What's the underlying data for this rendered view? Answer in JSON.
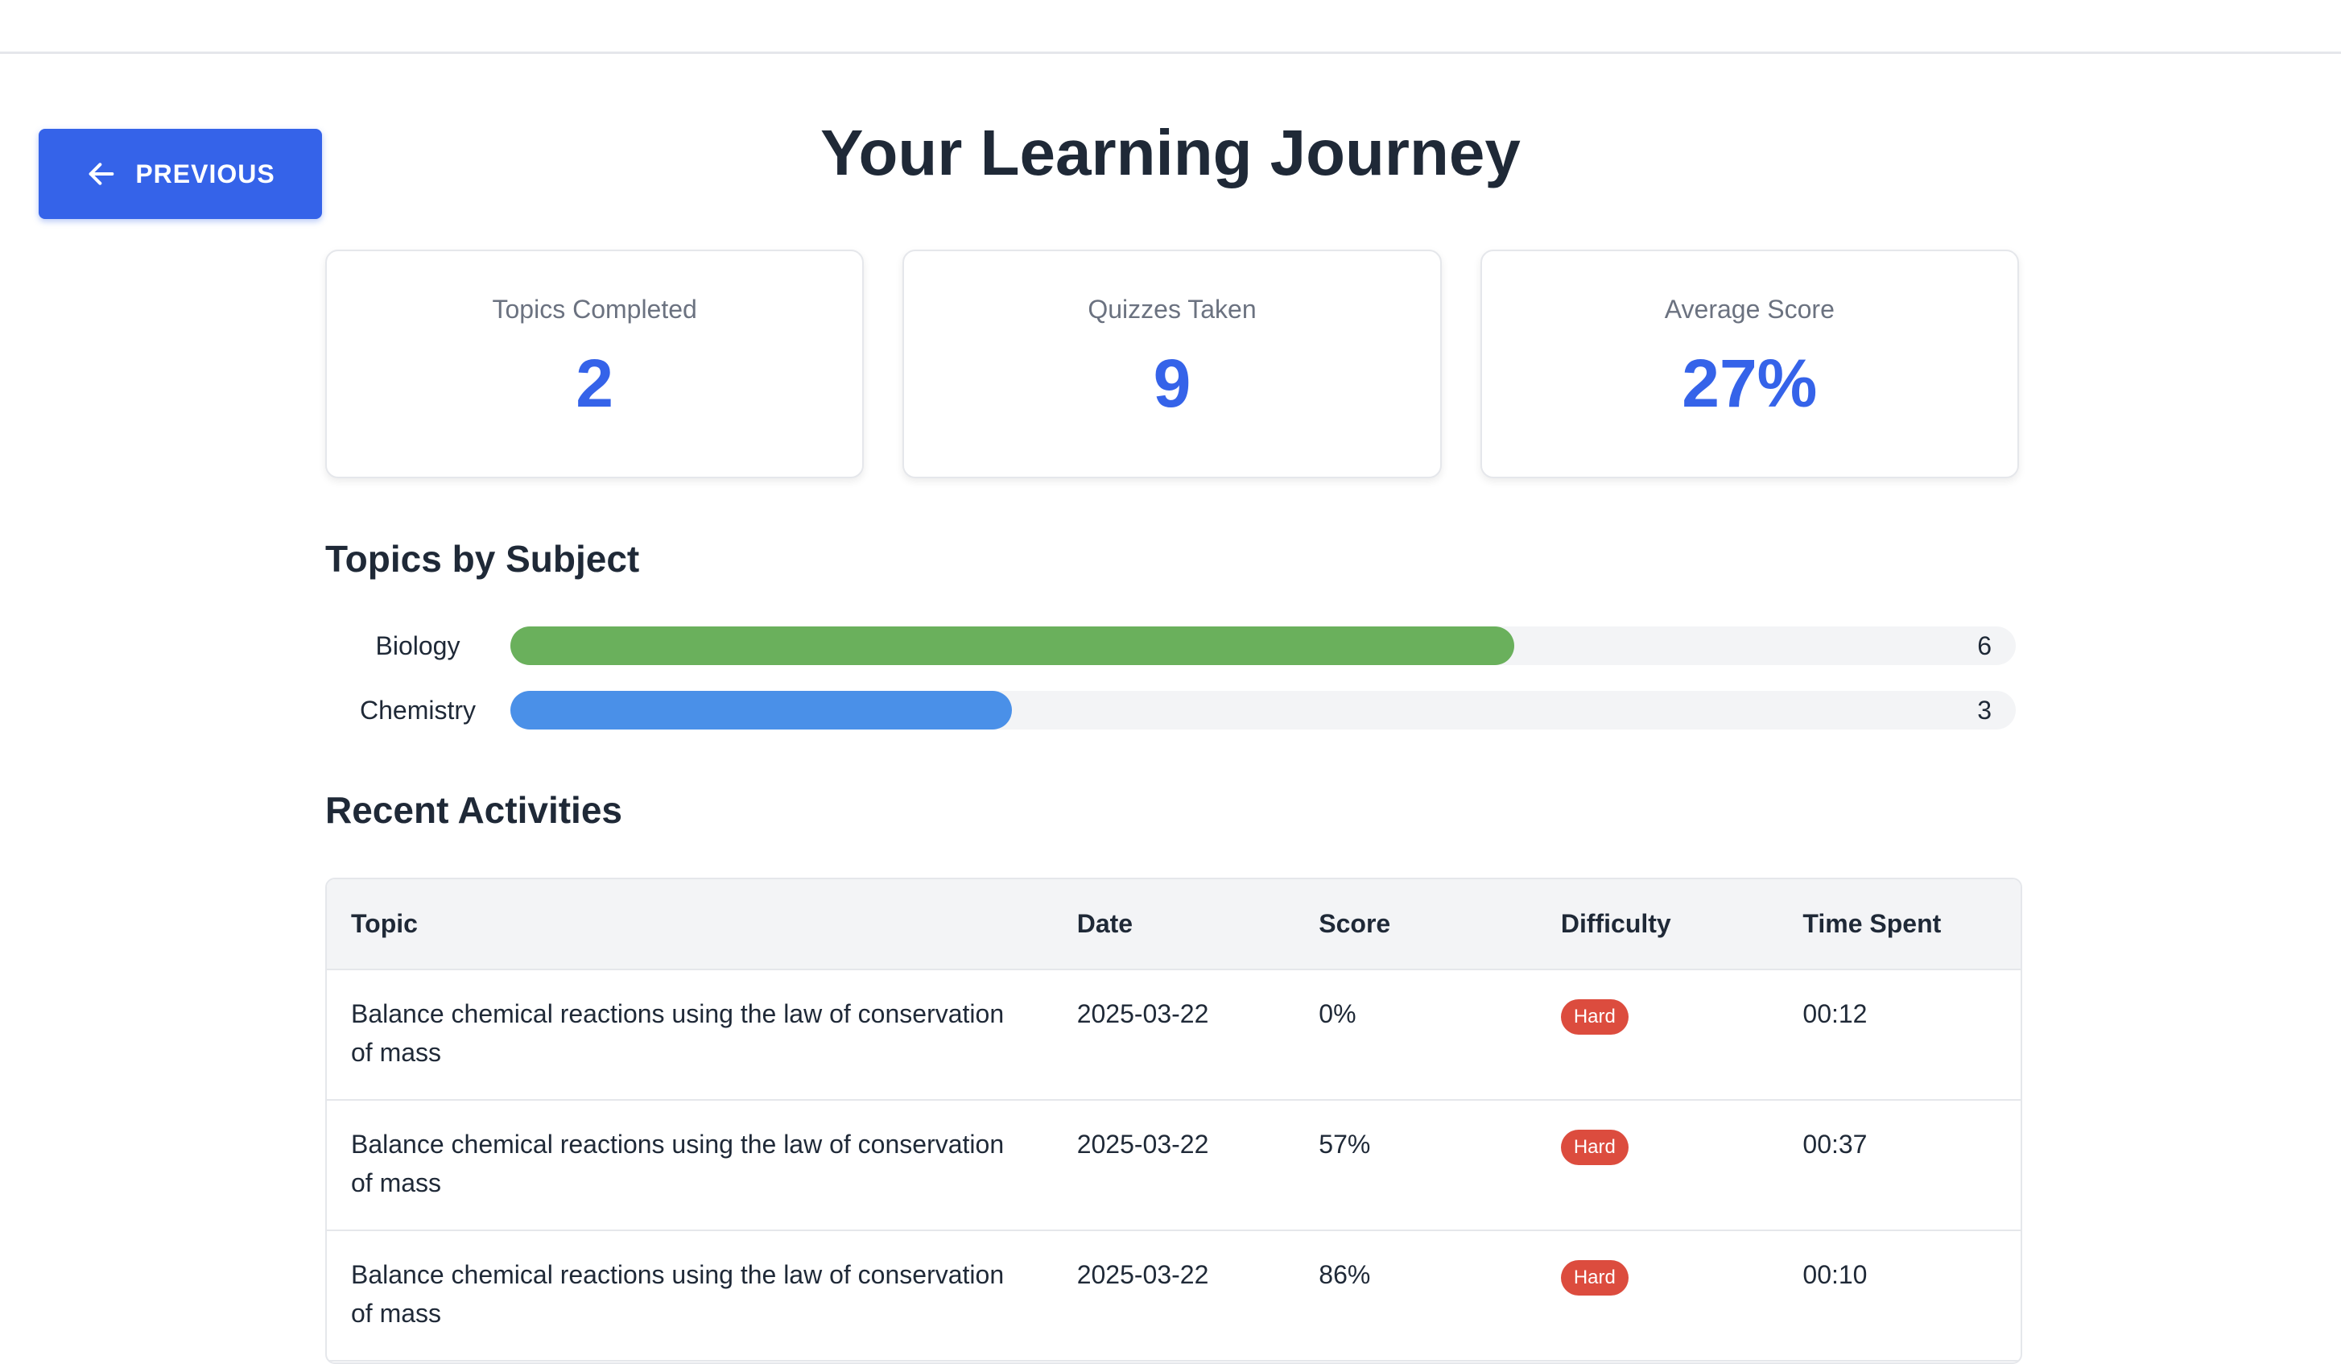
{
  "header": {
    "previous_label": "PREVIOUS",
    "title": "Your Learning Journey"
  },
  "stats": [
    {
      "label": "Topics Completed",
      "value": "2"
    },
    {
      "label": "Quizzes Taken",
      "value": "9"
    },
    {
      "label": "Average Score",
      "value": "27%"
    }
  ],
  "subjects": {
    "title": "Topics by Subject",
    "max": 9,
    "items": [
      {
        "name": "Biology",
        "count": "6",
        "value": 6,
        "color": "#6ab05c"
      },
      {
        "name": "Chemistry",
        "count": "3",
        "value": 3,
        "color": "#4a90e8"
      }
    ]
  },
  "activities": {
    "title": "Recent Activities",
    "columns": [
      "Topic",
      "Date",
      "Score",
      "Difficulty",
      "Time Spent"
    ],
    "rows": [
      {
        "topic": "Balance chemical reactions using the law of conservation of mass",
        "date": "2025-03-22",
        "score": "0%",
        "difficulty": "Hard",
        "time": "00:12"
      },
      {
        "topic": "Balance chemical reactions using the law of conservation of mass",
        "date": "2025-03-22",
        "score": "57%",
        "difficulty": "Hard",
        "time": "00:37"
      },
      {
        "topic": "Balance chemical reactions using the law of conservation of mass",
        "date": "2025-03-22",
        "score": "86%",
        "difficulty": "Hard",
        "time": "00:10"
      }
    ]
  },
  "colors": {
    "accent": "#3563e9",
    "badge_hard": "#dc4c3e"
  }
}
